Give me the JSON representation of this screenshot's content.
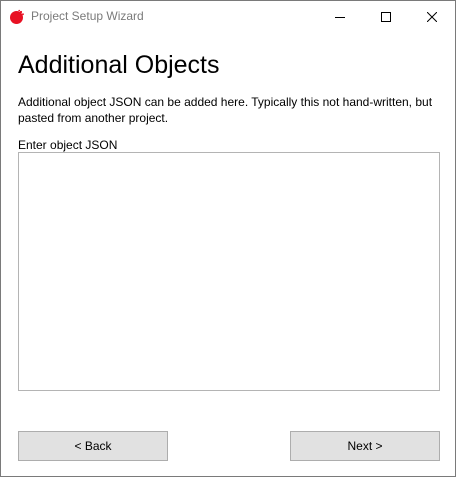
{
  "window": {
    "title": "Project Setup Wizard",
    "icon": "app-logo-icon",
    "accent_color": "#e81123",
    "controls": [
      "minimize-icon",
      "maximize-icon",
      "close-icon"
    ]
  },
  "page": {
    "heading": "Additional Objects",
    "description": "Additional object JSON can be added here. Typically this not hand-written, but pasted from another project."
  },
  "json_field": {
    "label": "Enter object JSON",
    "value": ""
  },
  "buttons": {
    "back_label": "< Back",
    "next_label": "Next >"
  }
}
